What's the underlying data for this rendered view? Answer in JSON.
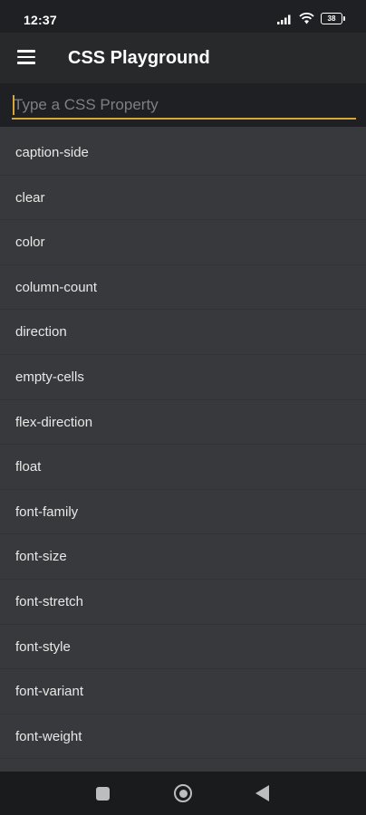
{
  "status_bar": {
    "time": "12:37",
    "battery": "38",
    "icons": [
      "signal-icon",
      "wifi-icon",
      "battery-icon"
    ]
  },
  "app_bar": {
    "title": "CSS Playground",
    "menu_icon": "hamburger-menu-icon"
  },
  "search": {
    "placeholder": "Type a CSS Property",
    "value": "",
    "accent_color": "#d6a63a"
  },
  "properties": [
    "caption-side",
    "clear",
    "color",
    "column-count",
    "direction",
    "empty-cells",
    "flex-direction",
    "float",
    "font-family",
    "font-size",
    "font-stretch",
    "font-style",
    "font-variant",
    "font-weight"
  ],
  "nav_bar": {
    "buttons": [
      "recents-icon",
      "home-icon",
      "back-icon"
    ]
  }
}
